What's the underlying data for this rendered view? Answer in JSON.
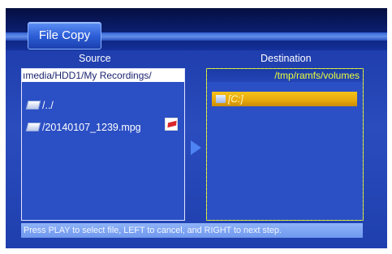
{
  "header": {
    "title": "File Copy"
  },
  "source": {
    "label": "Source",
    "path": "ımedia/HDD1/My Recordings/",
    "items": [
      {
        "icon": "folder-icon",
        "name": "/../"
      },
      {
        "icon": "folder-icon",
        "name": "/20140107_1239.mpg",
        "selected_mark": true
      }
    ]
  },
  "destination": {
    "label": "Destination",
    "path": "/tmp/ramfs/volumes",
    "items": [
      {
        "icon": "drive-icon",
        "name": "[C:]",
        "highlighted": true
      }
    ]
  },
  "status": {
    "hint": "Press PLAY to select file, LEFT to cancel, and RIGHT to next step."
  },
  "colors": {
    "background": "#2a4cbd",
    "highlight": "#e8a80c",
    "destination_path": "#e8ff3a",
    "checkmark": "#d8262b"
  }
}
